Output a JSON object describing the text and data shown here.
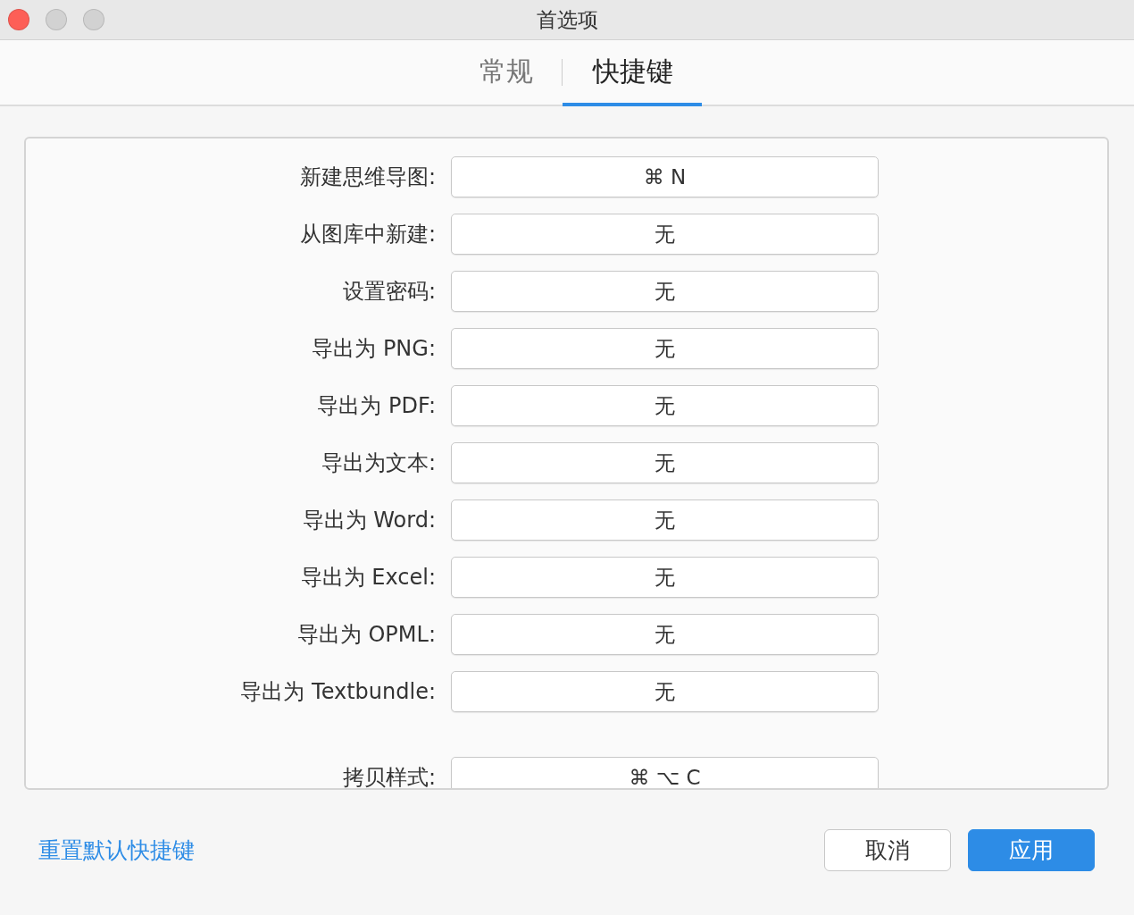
{
  "window": {
    "title": "首选项"
  },
  "tabs": [
    {
      "label": "常规",
      "selected": false
    },
    {
      "label": "快捷键",
      "selected": true
    }
  ],
  "sections": [
    {
      "rows": [
        {
          "label": "新建思维导图:",
          "value": "⌘ N"
        },
        {
          "label": "从图库中新建:",
          "value": "无"
        },
        {
          "label": "设置密码:",
          "value": "无"
        },
        {
          "label": "导出为 PNG:",
          "value": "无"
        },
        {
          "label": "导出为 PDF:",
          "value": "无"
        },
        {
          "label": "导出为文本:",
          "value": "无"
        },
        {
          "label": "导出为 Word:",
          "value": "无"
        },
        {
          "label": "导出为 Excel:",
          "value": "无"
        },
        {
          "label": "导出为 OPML:",
          "value": "无"
        },
        {
          "label": "导出为 Textbundle:",
          "value": "无"
        }
      ]
    },
    {
      "rows": [
        {
          "label": "拷贝样式:",
          "value": "⌘ ⌥ C"
        }
      ]
    }
  ],
  "footer": {
    "reset_link": "重置默认快捷键",
    "buttons": [
      {
        "label": "取消",
        "kind": "secondary"
      },
      {
        "label": "应用",
        "kind": "primary"
      }
    ]
  }
}
